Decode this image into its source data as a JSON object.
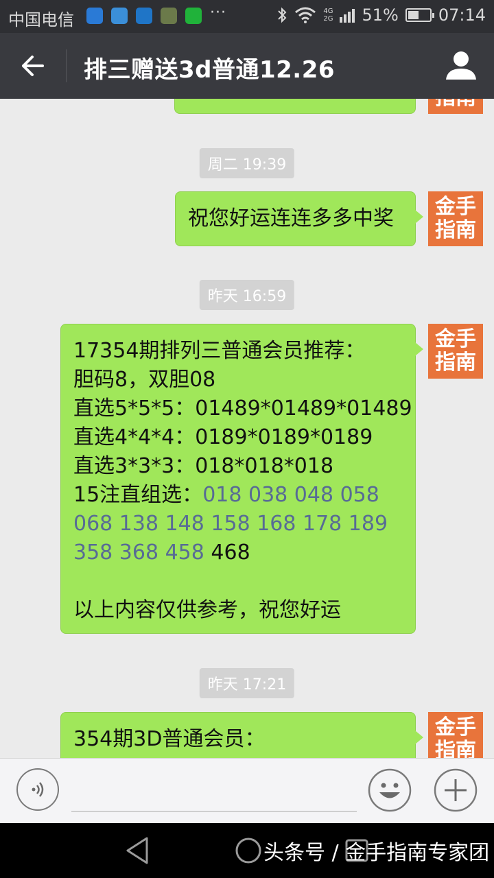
{
  "status_bar": {
    "carrier": "中国电信",
    "more": "···",
    "network_tag_top": "4G",
    "network_tag_bottom": "2G",
    "battery_percent": "51%",
    "battery_level": 0.51,
    "time": "07:14",
    "notification_icons": [
      "browser-icon",
      "health-icon",
      "app-icon",
      "photo-app-icon",
      "wechat-icon"
    ],
    "notification_colors": [
      "#2a7ad6",
      "#3b8fd9",
      "#1f75c7",
      "#6b7a4a",
      "#20b23a"
    ]
  },
  "title_bar": {
    "title": "排三赠送3d普通12.26"
  },
  "avatar": {
    "line1": "金手",
    "line2": "指南",
    "color": "#e8743b"
  },
  "timestamps": [
    "周二 19:39",
    "昨天 16:59",
    "昨天 17:21"
  ],
  "messages": [
    {
      "lines": []
    },
    {
      "lines": [
        "祝您好运连连多多中奖"
      ]
    },
    {
      "line1": "17354期排列三普通会员推荐：",
      "line2": "胆码8，双胆08",
      "line3": "直选5*5*5：01489*01489*01489",
      "line4": "直选4*4*4：0189*0189*0189",
      "line5": "直选3*3*3：018*018*018",
      "line6_prefix": "15注直组选：",
      "line6_link": "018 038 048 058",
      "line7_link": "068 138 148 158 168 178 189",
      "line8_link": "358 368 458",
      "line8_suffix": " 468",
      "line9": "以上内容仅供参考，祝您好运"
    },
    {
      "lines": [
        "354期3D普通会员："
      ]
    }
  ],
  "colors": {
    "bubble": "#a0e75a",
    "link": "#576b95",
    "title_bar": "#393a3f"
  },
  "watermark": "头条号 / 金手指南专家团"
}
